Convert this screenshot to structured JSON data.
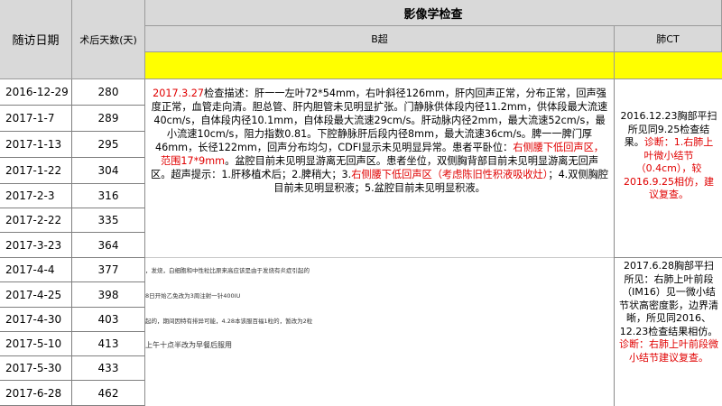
{
  "table": {
    "col_date": "随访日期",
    "col_days": "术后天数(天)",
    "section_title": "影像学检查",
    "sub_bchao": "B超",
    "sub_ct": "肺CT"
  },
  "rows": [
    {
      "date": "2016-12-29",
      "days": "280"
    },
    {
      "date": "2017-1-7",
      "days": "289"
    },
    {
      "date": "2017-1-13",
      "days": "295"
    },
    {
      "date": "2017-1-22",
      "days": "304"
    },
    {
      "date": "2017-2-3",
      "days": "316"
    },
    {
      "date": "2017-2-22",
      "days": "335"
    },
    {
      "date": "2017-3-23",
      "days": "364"
    },
    {
      "date": "2017-4-4",
      "days": "377"
    },
    {
      "date": "2017-4-25",
      "days": "398"
    },
    {
      "date": "2017-4-30",
      "days": "403"
    },
    {
      "date": "2017-5-10",
      "days": "413"
    },
    {
      "date": "2017-5-30",
      "days": "433"
    },
    {
      "date": "2017-6-28",
      "days": "462"
    }
  ],
  "bchao_text": {
    "p1_red": "2017.3.27",
    "p1": "检查描述：肝一一左叶72*54mm，右叶斜径126mm，肝内回声正常，分布正常，回声强度正常，血管走向清。胆总管、肝内胆管未见明显扩张。门静脉供体段内径11.2mm，供体段最大流速40cm/s，自体段内径10.1mm，自体段最大流速29cm/s。肝动脉内径2mm，最大流速52cm/s，最小流速10cm/s，阻力指数0.81。下腔静脉肝后段内径8mm，最大流速36cm/s。脾一一脾门厚46mm，长径122mm，回声分布均匀，CDFI显示未见明显异常。患者平卧位：",
    "p2_red": "右侧腰下低回声区，范围17*9mm",
    "p3": "。盆腔目前未见明显游离无回声区。患者坐位，双侧胸背部目前未见明显游离无回声区。超声提示：1.肝移植术后；2.脾稍大；3.",
    "p4_red": "右侧腰下低回声区（考虑陈旧性积液吸收灶）",
    "p5": "；4.双侧胸腔目前未见明显积液；5.盆腔目前未见明显积液。"
  },
  "ct_text_1": {
    "normal": "2016.12.23胸部平扫所见同9.25检查结果。",
    "red": "诊断：1.右肺上叶微小结节（0.4cm），较2016.9.25相仿，建议复查。"
  },
  "ct_text_2": {
    "normal": "2017.6.28胸部平扫所见：右肺上叶前段（IM16）见一微小结节状高密度影，边界清晰，所见同2016、12.23检查结果相仿。",
    "red": "诊断：右肺上叶前段微小结节建议复查。"
  },
  "notes": [
    "，发烧，白细胞和中性粒比原来高应该是由于发烧有炎症引起的",
    "8日开始乙免改为3周注射一针400IU",
    "起的，期间因特有排异可能，4.28本该服百福1粒的，暂改为2粒",
    "上午十点半改为早餐后服用"
  ],
  "colors": {
    "header_bg": "#d9d9d9",
    "yellow_band": "#ffff00",
    "red_text": "#e00000"
  }
}
